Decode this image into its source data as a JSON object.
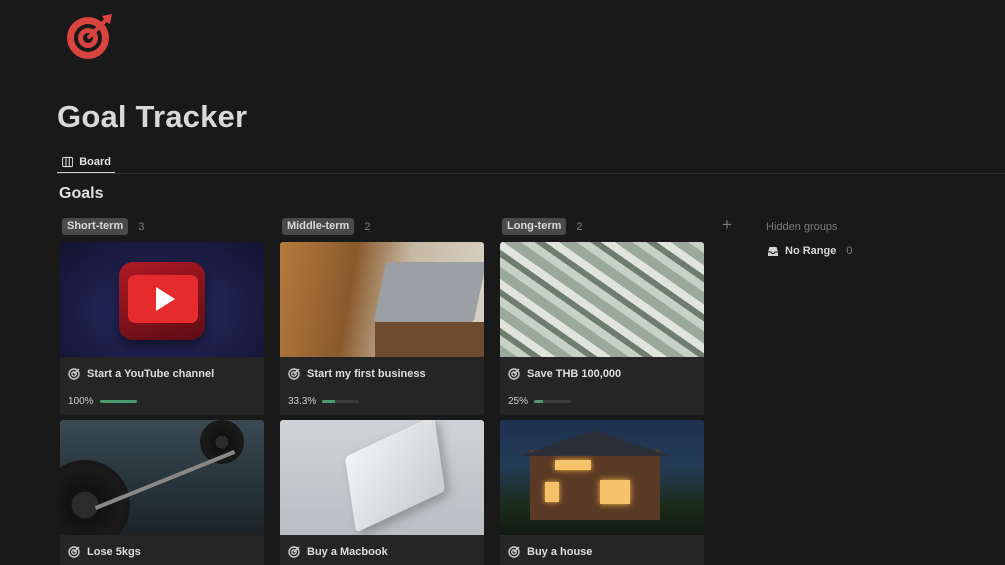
{
  "page": {
    "title": "Goal Tracker",
    "icon": "target-icon",
    "accent": "#d9443f"
  },
  "views": [
    {
      "label": "Board",
      "icon": "board-icon",
      "active": true
    }
  ],
  "section": {
    "title": "Goals"
  },
  "columns": [
    {
      "name": "Short-term",
      "count": "3",
      "cards": [
        {
          "title": "Start a YouTube channel",
          "progress_text": "100%",
          "progress": 1.0
        },
        {
          "title": "Lose 5kgs"
        }
      ]
    },
    {
      "name": "Middle-term",
      "count": "2",
      "cards": [
        {
          "title": "Start my first business",
          "progress_text": "33.3%",
          "progress": 0.333
        },
        {
          "title": "Buy a Macbook"
        }
      ]
    },
    {
      "name": "Long-term",
      "count": "2",
      "cards": [
        {
          "title": "Save THB 100,000",
          "progress_text": "25%",
          "progress": 0.25
        },
        {
          "title": "Buy a house"
        }
      ]
    }
  ],
  "hidden_groups": {
    "label": "Hidden groups",
    "items": [
      {
        "name": "No Range",
        "count": "0"
      }
    ]
  },
  "colors": {
    "background": "#191919",
    "card": "#252525",
    "progress": "#4a9c6d",
    "pill": "#4a4a4a"
  }
}
